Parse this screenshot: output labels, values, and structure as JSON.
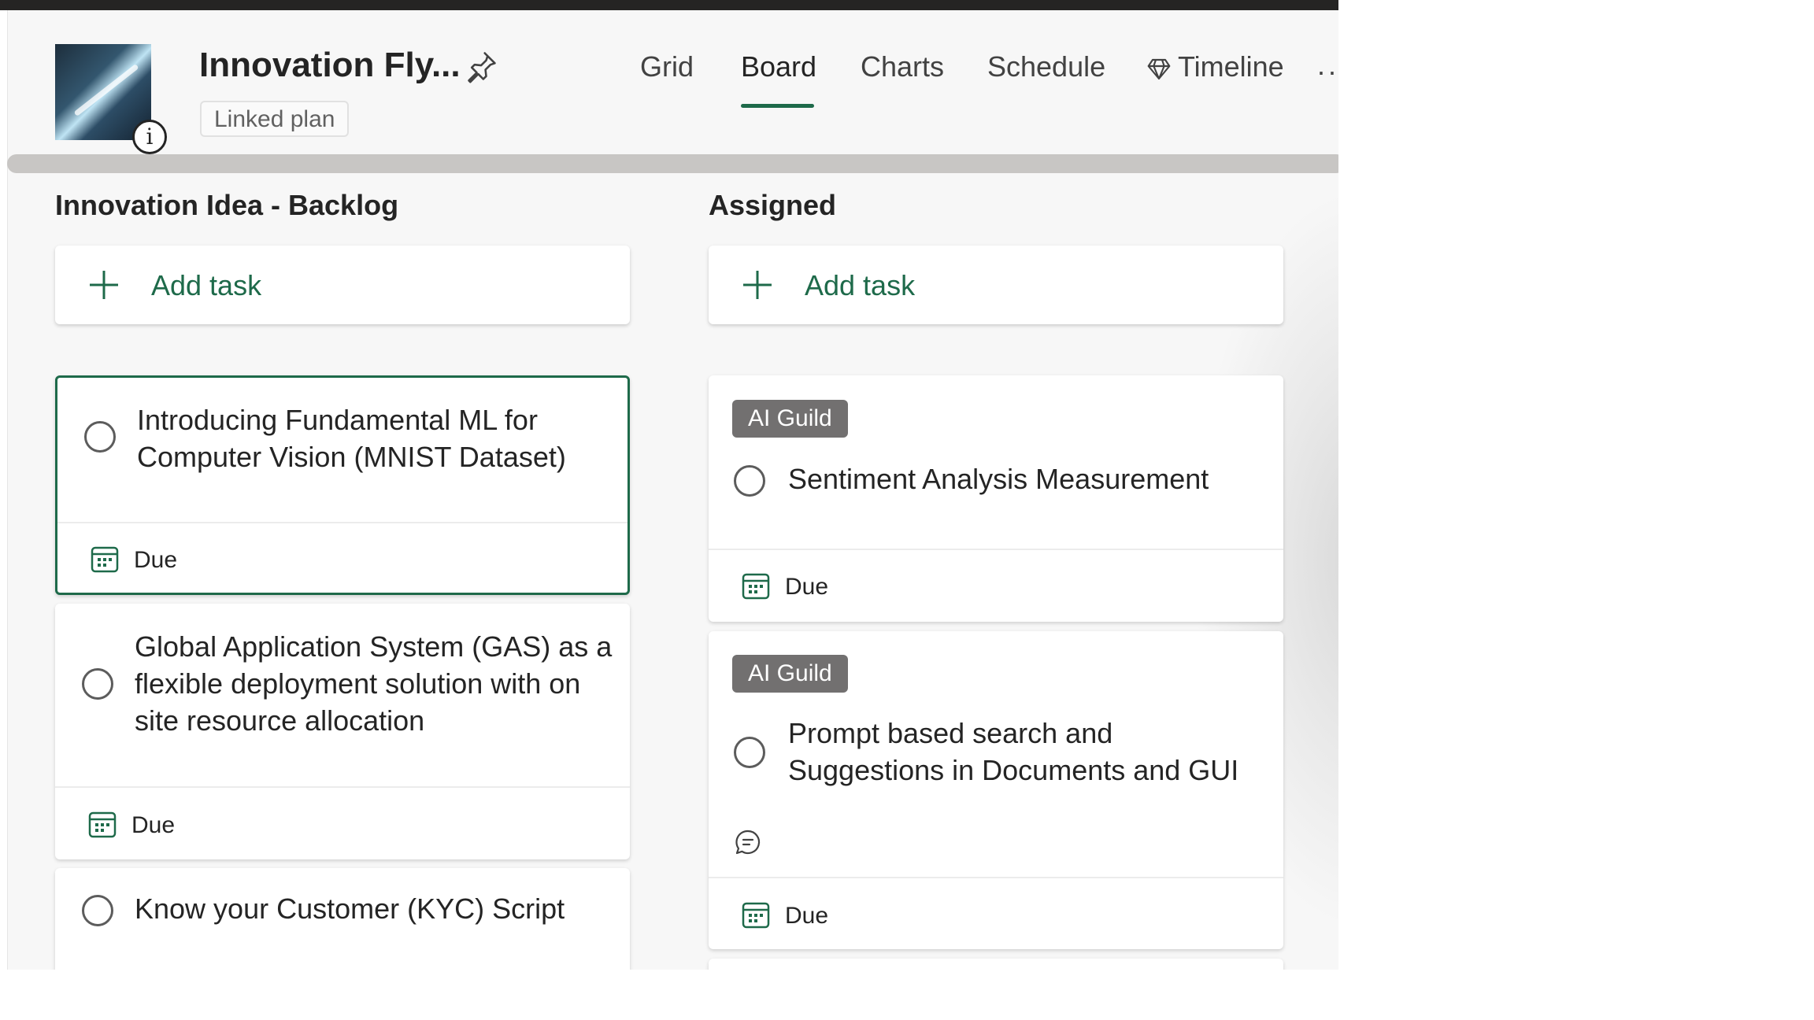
{
  "header": {
    "plan_title": "Innovation Fly...",
    "linked_label": "Linked plan",
    "tabs": [
      {
        "label": "Grid"
      },
      {
        "label": "Board"
      },
      {
        "label": "Charts"
      },
      {
        "label": "Schedule"
      },
      {
        "label": "Timeline"
      }
    ],
    "active_tab": "Board",
    "more_label": "··"
  },
  "colors": {
    "accent": "#1e6a4a",
    "label_chip": "#727070",
    "top_bar": "#252423"
  },
  "icons": [
    "info-icon",
    "pin-icon",
    "diamond-icon",
    "more-icon",
    "plus-icon",
    "calendar-icon",
    "comment-icon"
  ],
  "buckets": [
    {
      "title": "Innovation Idea - Backlog",
      "add_task_label": "Add task",
      "tasks": [
        {
          "title_lines": [
            "Introducing Fundamental ML for",
            "Computer Vision (MNIST Dataset)"
          ],
          "due_label": "Due",
          "selected": true
        },
        {
          "title_lines": [
            "Global Application System (GAS) as a",
            "flexible deployment solution with on",
            "site resource allocation"
          ],
          "due_label": "Due"
        },
        {
          "title_lines": [
            "Know your Customer (KYC) Script"
          ]
        }
      ]
    },
    {
      "title": "Assigned",
      "add_task_label": "Add task",
      "tasks": [
        {
          "label": "AI Guild",
          "title_lines": [
            "Sentiment Analysis Measurement"
          ],
          "due_label": "Due"
        },
        {
          "label": "AI Guild",
          "title_lines": [
            "Prompt based search and",
            "Suggestions in Documents and GUI"
          ],
          "due_label": "Due",
          "has_comments": true
        }
      ]
    }
  ]
}
